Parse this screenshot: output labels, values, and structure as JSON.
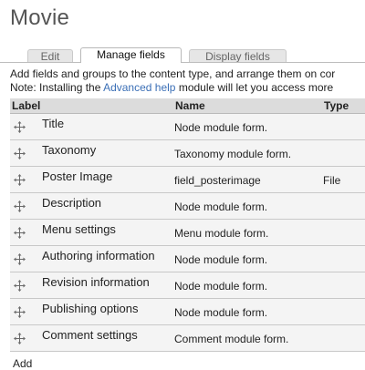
{
  "page": {
    "title": "Movie"
  },
  "tabs": [
    {
      "label": "Edit",
      "active": false
    },
    {
      "label": "Manage fields",
      "active": true
    },
    {
      "label": "Display fields",
      "active": false
    }
  ],
  "description": {
    "line1": "Add fields and groups to the content type, and arrange them on cor",
    "line2_prefix": "Note: Installing the ",
    "line2_link": "Advanced help",
    "line2_suffix": " module will let you access more"
  },
  "table": {
    "headers": {
      "label": "Label",
      "name": "Name",
      "type": "Type"
    },
    "rows": [
      {
        "label": "Title",
        "name": "Node module form.",
        "type": ""
      },
      {
        "label": "Taxonomy",
        "name": "Taxonomy module form.",
        "type": ""
      },
      {
        "label": "Poster Image",
        "name": "field_posterimage",
        "type": "File"
      },
      {
        "label": "Description",
        "name": "Node module form.",
        "type": ""
      },
      {
        "label": "Menu settings",
        "name": "Menu module form.",
        "type": ""
      },
      {
        "label": "Authoring information",
        "name": "Node module form.",
        "type": ""
      },
      {
        "label": "Revision information",
        "name": "Node module form.",
        "type": ""
      },
      {
        "label": "Publishing options",
        "name": "Node module form.",
        "type": ""
      },
      {
        "label": "Comment settings",
        "name": "Comment module form.",
        "type": ""
      }
    ]
  },
  "footer": {
    "add_label": "Add"
  },
  "colors": {
    "link": "#3b6fb6",
    "header_bg": "#dcdcdc",
    "row_bg": "#f4f4f4"
  },
  "icons": {
    "drag": "move-cross-icon"
  }
}
